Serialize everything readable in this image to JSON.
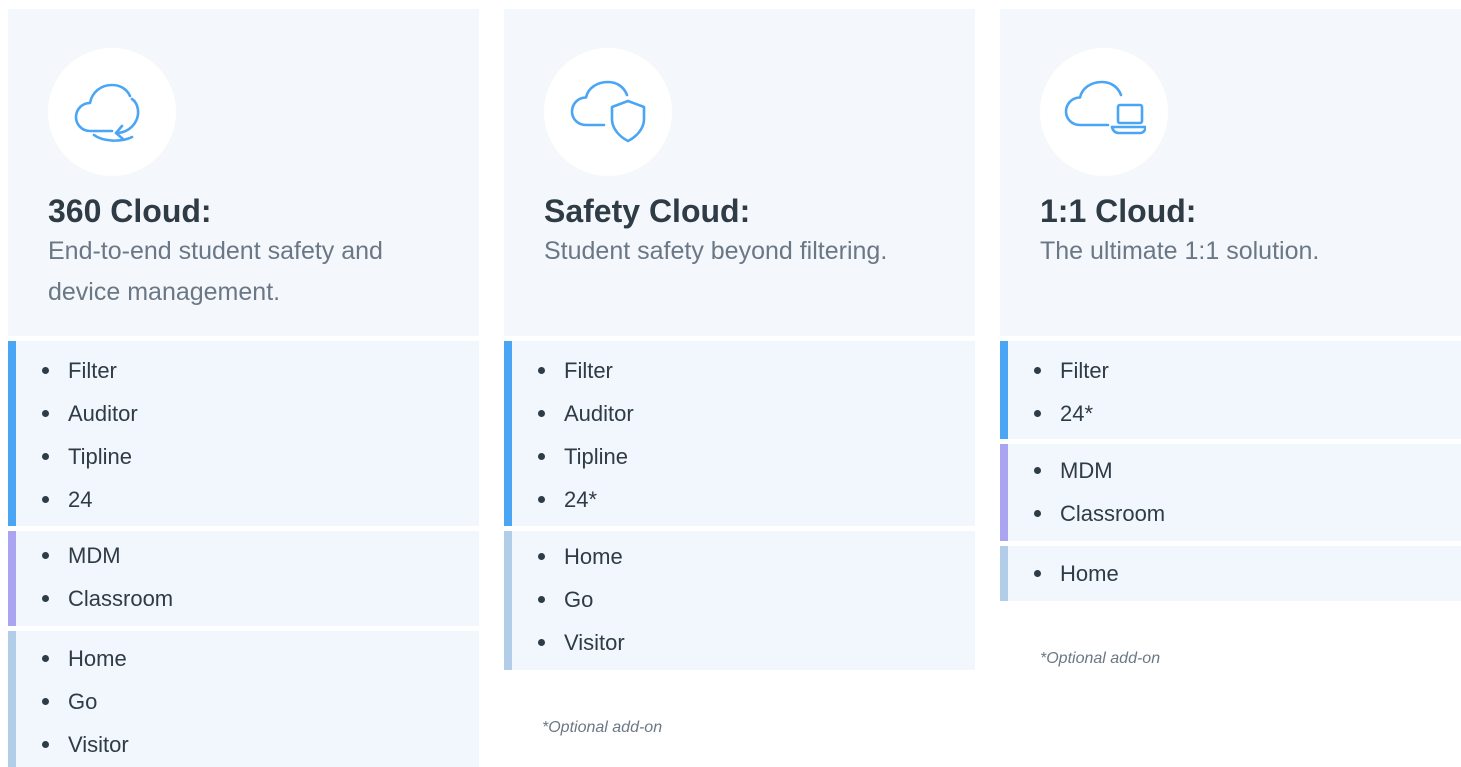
{
  "colors": {
    "accent_blue": "#4aa5f5",
    "accent_purple": "#aaa4f1",
    "accent_light_blue": "#b1cde8",
    "card_bg": "#f4f8fc",
    "title": "#2f3b45",
    "muted": "#6b7785"
  },
  "plans": [
    {
      "icon": "cloud-sync-icon",
      "title": "360 Cloud:",
      "description": "End-to-end student safety and device management.",
      "groups": [
        {
          "color": "#4aa5f5",
          "items": [
            "Filter",
            "Auditor",
            "Tipline",
            "24"
          ]
        },
        {
          "color": "#aaa4f1",
          "items": [
            "MDM",
            "Classroom"
          ]
        },
        {
          "color": "#b1cde8",
          "items": [
            "Home",
            "Go",
            "Visitor"
          ]
        }
      ],
      "footnote": ""
    },
    {
      "icon": "cloud-shield-icon",
      "title": "Safety Cloud:",
      "description": "Student safety beyond filtering.",
      "groups": [
        {
          "color": "#4aa5f5",
          "items": [
            "Filter",
            "Auditor",
            "Tipline",
            "24*"
          ]
        },
        {
          "color": "#b1cde8",
          "items": [
            "Home",
            "Go",
            "Visitor"
          ]
        }
      ],
      "footnote": "*Optional add-on"
    },
    {
      "icon": "cloud-laptop-icon",
      "title": "1:1 Cloud:",
      "description": "The ultimate 1:1 solution.",
      "groups": [
        {
          "color": "#4aa5f5",
          "items": [
            "Filter",
            "24*"
          ]
        },
        {
          "color": "#aaa4f1",
          "items": [
            "MDM",
            "Classroom"
          ]
        },
        {
          "color": "#b1cde8",
          "items": [
            "Home"
          ]
        }
      ],
      "footnote": "*Optional add-on"
    }
  ]
}
